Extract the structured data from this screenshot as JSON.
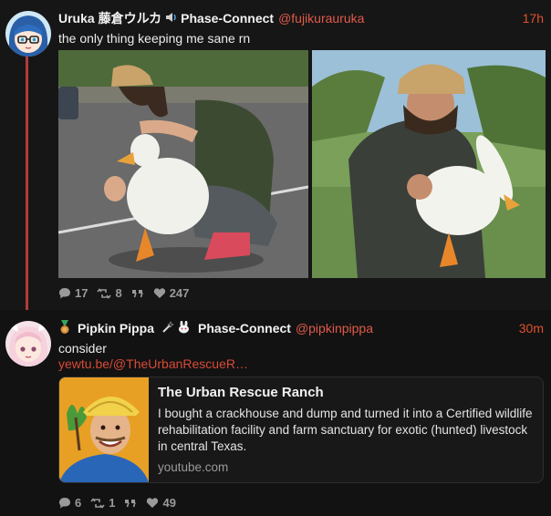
{
  "posts": [
    {
      "display_name": "Uruka 藤倉ウルカ",
      "affiliation": "Phase-Connect",
      "handle": "@fujikurauruka",
      "time": "17h",
      "text": "the only thing keeping me sane rn",
      "replies": "17",
      "reposts": "8",
      "likes": "247"
    },
    {
      "display_name": "Pipkin Pippa",
      "affiliation": "Phase-Connect",
      "handle": "@pipkinpippa",
      "time": "30m",
      "text": "consider",
      "link": "yewtu.be/@TheUrbanRescueR…",
      "card": {
        "title": "The Urban Rescue Ranch",
        "description": "I bought a crackhouse and dump and turned it into a Certified wildlife rehabilitation facility and farm sanctuary for exotic (hunted) livestock in central Texas.",
        "domain": "youtube.com"
      },
      "replies": "6",
      "reposts": "1",
      "likes": "49"
    }
  ],
  "colors": {
    "accent": "#e05a4a",
    "thread_line": "#b33a3a",
    "muted": "#9a9a9a"
  },
  "icons": [
    "reply-icon",
    "repost-icon",
    "quote-icon",
    "like-icon",
    "speaker-icon",
    "medal-icon",
    "rabbit-icon"
  ]
}
